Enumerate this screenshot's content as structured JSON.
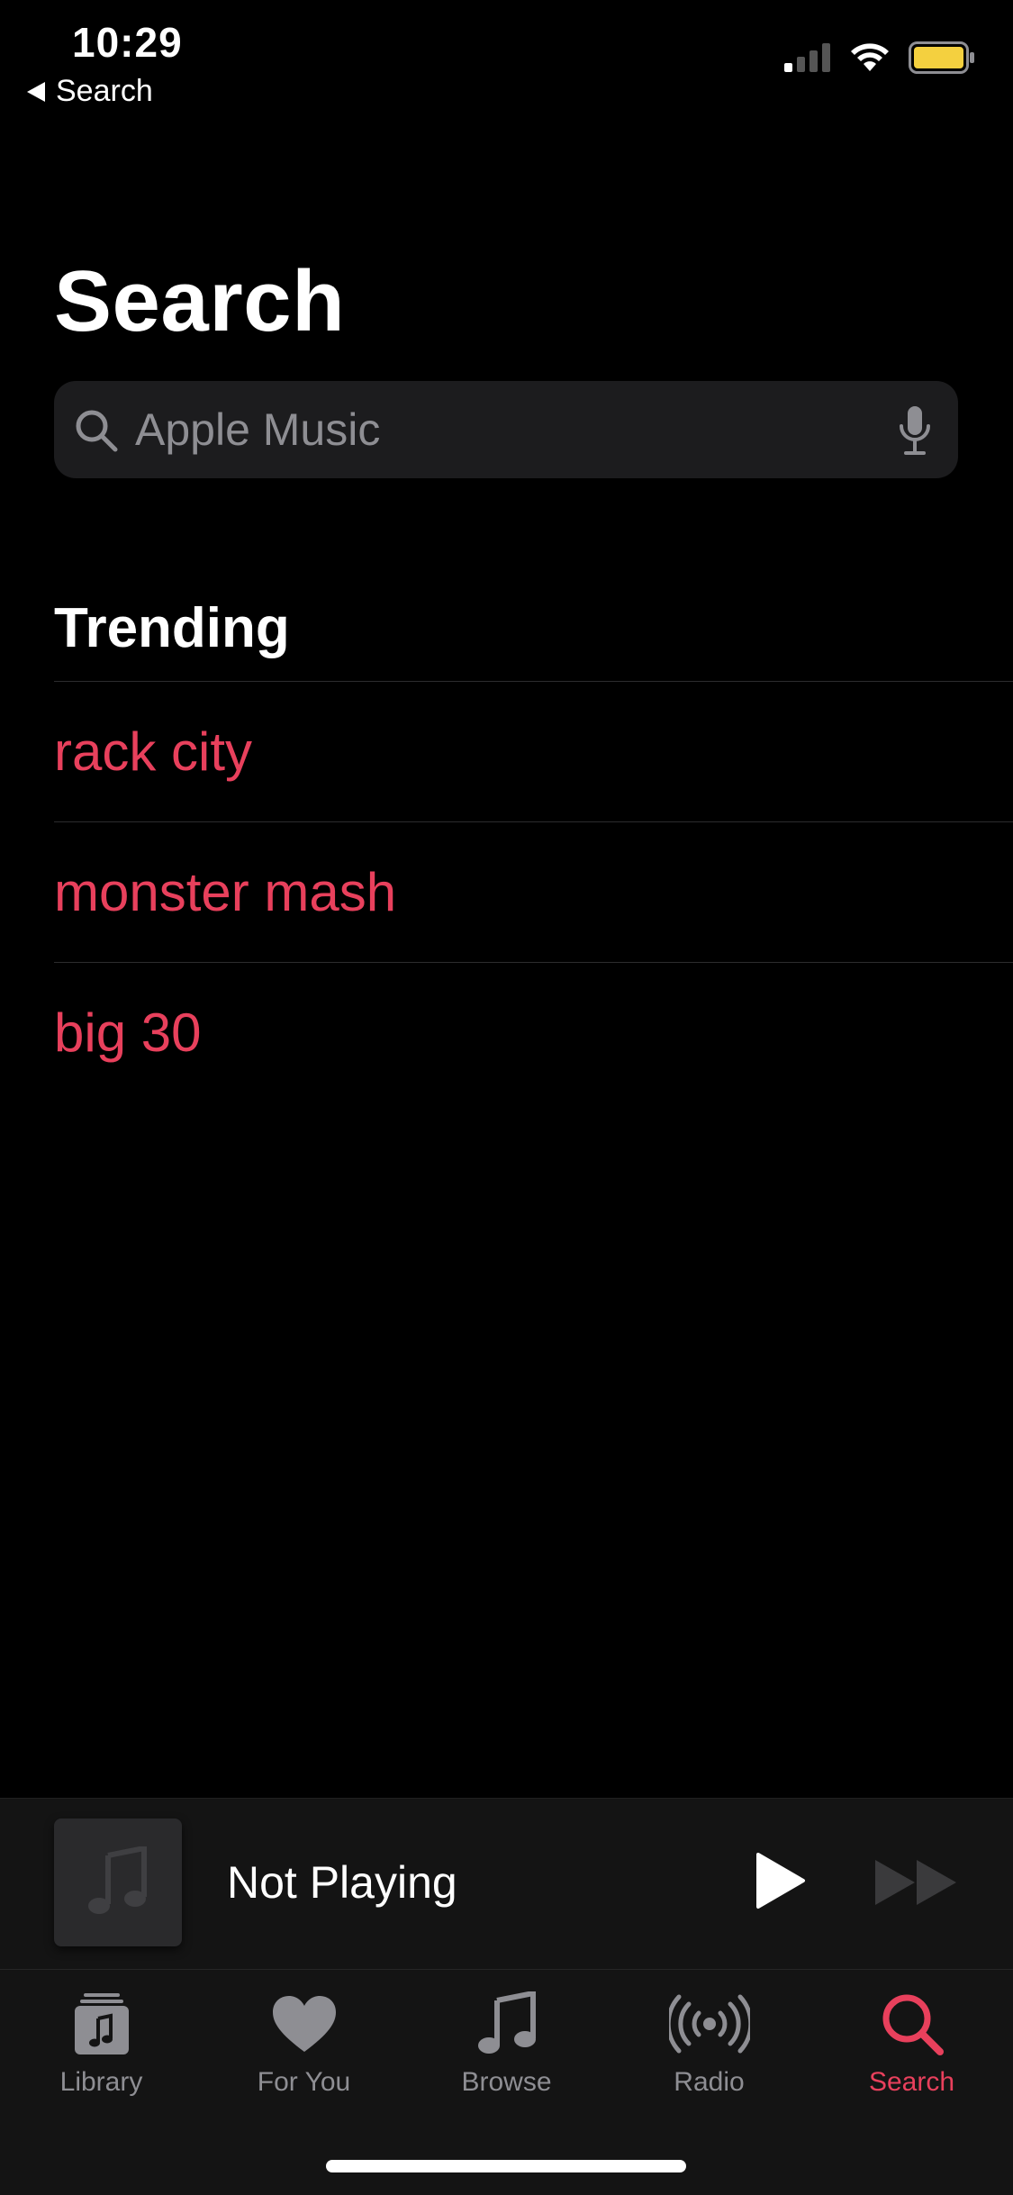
{
  "status_bar": {
    "time": "10:29",
    "back_label": "Search"
  },
  "page": {
    "title": "Search"
  },
  "search": {
    "placeholder": "Apple Music"
  },
  "trending": {
    "heading": "Trending",
    "items": [
      "rack city",
      "monster mash",
      "big 30"
    ]
  },
  "mini_player": {
    "title": "Not Playing"
  },
  "tab_bar": {
    "tabs": [
      {
        "label": "Library",
        "icon": "library-icon"
      },
      {
        "label": "For You",
        "icon": "heart-icon"
      },
      {
        "label": "Browse",
        "icon": "music-note-icon"
      },
      {
        "label": "Radio",
        "icon": "radio-icon"
      },
      {
        "label": "Search",
        "icon": "search-icon"
      }
    ],
    "active": "Search"
  },
  "colors": {
    "accent": "#e8405c",
    "background": "#000000",
    "field_bg": "#1c1c1e",
    "inactive_tab": "#8e8e93"
  }
}
